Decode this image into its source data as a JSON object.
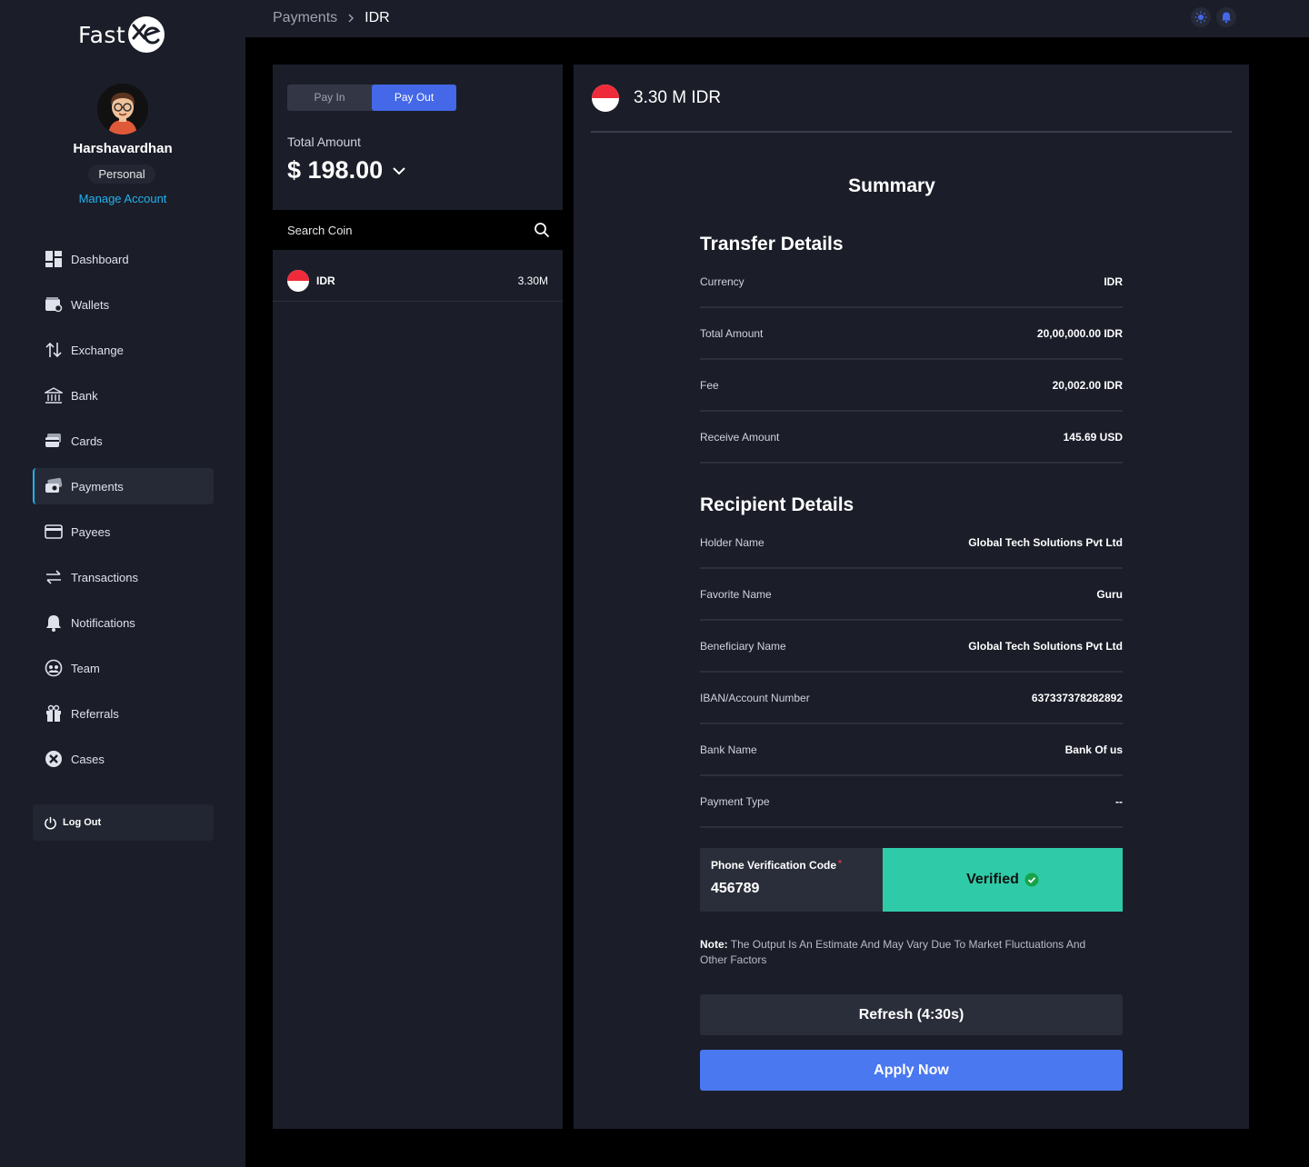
{
  "brand": {
    "name": "Fast",
    "mark_icon": "xe-logo-icon"
  },
  "user": {
    "name": "Harshavardhan",
    "type": "Personal",
    "manage_label": "Manage Account"
  },
  "nav": {
    "items": [
      {
        "label": "Dashboard",
        "icon": "dashboard-icon"
      },
      {
        "label": "Wallets",
        "icon": "wallet-icon"
      },
      {
        "label": "Exchange",
        "icon": "exchange-icon"
      },
      {
        "label": "Bank",
        "icon": "bank-icon"
      },
      {
        "label": "Cards",
        "icon": "card-icon"
      },
      {
        "label": "Payments",
        "icon": "payments-icon",
        "active": true
      },
      {
        "label": "Payees",
        "icon": "payee-icon"
      },
      {
        "label": "Transactions",
        "icon": "transactions-icon"
      },
      {
        "label": "Notifications",
        "icon": "bell-icon"
      },
      {
        "label": "Team",
        "icon": "team-icon"
      },
      {
        "label": "Referrals",
        "icon": "gift-icon"
      },
      {
        "label": "Cases",
        "icon": "cases-icon"
      }
    ],
    "logout_label": "Log Out"
  },
  "breadcrumb": {
    "parent": "Payments",
    "current": "IDR"
  },
  "payment": {
    "tab_pay_in": "Pay In",
    "tab_pay_out": "Pay Out",
    "total_label": "Total Amount",
    "total_value": "$ 198.00",
    "search_placeholder": "Search Coin",
    "coins": [
      {
        "name": "IDR",
        "value": "3.30M"
      }
    ]
  },
  "detail": {
    "title": "3.30 M IDR",
    "summary_label": "Summary",
    "transfer_title": "Transfer Details",
    "transfer": [
      {
        "label": "Currency",
        "value": "IDR"
      },
      {
        "label": "Total Amount",
        "value": "20,00,000.00 IDR"
      },
      {
        "label": "Fee",
        "value": "20,002.00 IDR"
      },
      {
        "label": "Receive Amount",
        "value": "145.69 USD"
      }
    ],
    "recipient_title": "Recipient Details",
    "recipient": [
      {
        "label": "Holder Name",
        "value": "Global Tech Solutions Pvt Ltd"
      },
      {
        "label": "Favorite Name",
        "value": "Guru"
      },
      {
        "label": "Beneficiary Name",
        "value": "Global Tech Solutions Pvt Ltd"
      },
      {
        "label": "IBAN/Account Number",
        "value": "637337378282892"
      },
      {
        "label": "Bank Name",
        "value": "Bank Of us"
      },
      {
        "label": "Payment Type",
        "value": "--"
      }
    ],
    "verify_label": "Phone Verification Code",
    "verify_required": "*",
    "verify_value": "456789",
    "verified_label": "Verified",
    "note_label": "Note:",
    "note_text": " The Output Is An Estimate And May Vary Due To Market Fluctuations And Other Factors",
    "refresh_label": "Refresh (4:30s)",
    "apply_label": "Apply Now"
  },
  "colors": {
    "accent": "#4468e8",
    "link": "#23b2f0",
    "verified": "#2fcba8",
    "apply": "#4a78f0"
  }
}
